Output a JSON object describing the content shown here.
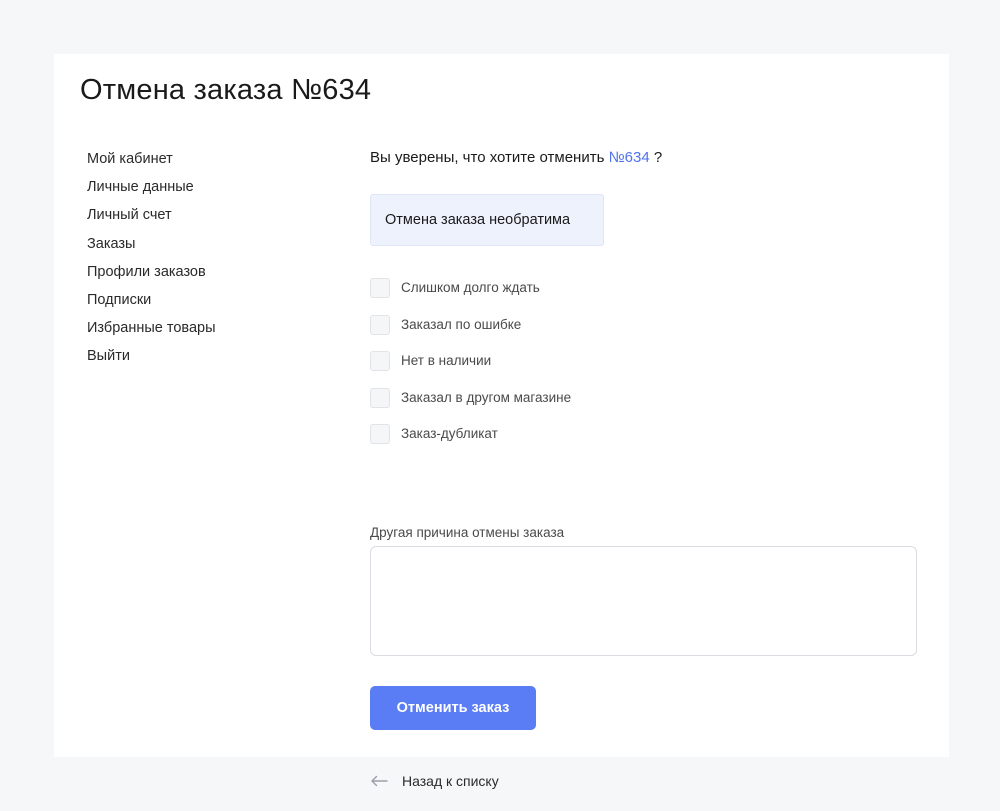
{
  "page": {
    "title": "Отмена заказа №634"
  },
  "sidebar": {
    "items": [
      {
        "label": "Мой кабинет"
      },
      {
        "label": "Личные данные"
      },
      {
        "label": "Личный счет"
      },
      {
        "label": "Заказы"
      },
      {
        "label": "Профили заказов"
      },
      {
        "label": "Подписки"
      },
      {
        "label": "Избранные товары"
      },
      {
        "label": "Выйти"
      }
    ]
  },
  "form": {
    "question_prefix": "Вы уверены, что хотите отменить",
    "order_link": "№634",
    "question_suffix": "?",
    "notice": "Отмена заказа необратима",
    "reasons": [
      {
        "label": "Слишком долго ждать",
        "checked": false
      },
      {
        "label": "Заказал по ошибке",
        "checked": false
      },
      {
        "label": "Нет в наличии",
        "checked": false
      },
      {
        "label": "Заказал в другом магазине",
        "checked": false
      },
      {
        "label": "Заказ-дубликат",
        "checked": false
      }
    ],
    "other_label": "Другая причина отмены заказа",
    "other_value": "",
    "submit_label": "Отменить заказ",
    "back_label": "Назад к списку"
  },
  "colors": {
    "accent": "#5a7df5",
    "link": "#4f72f0",
    "notice_bg": "#eef2fd",
    "page_bg": "#f6f7f9"
  },
  "icons": {
    "back": "arrow-left-icon"
  }
}
